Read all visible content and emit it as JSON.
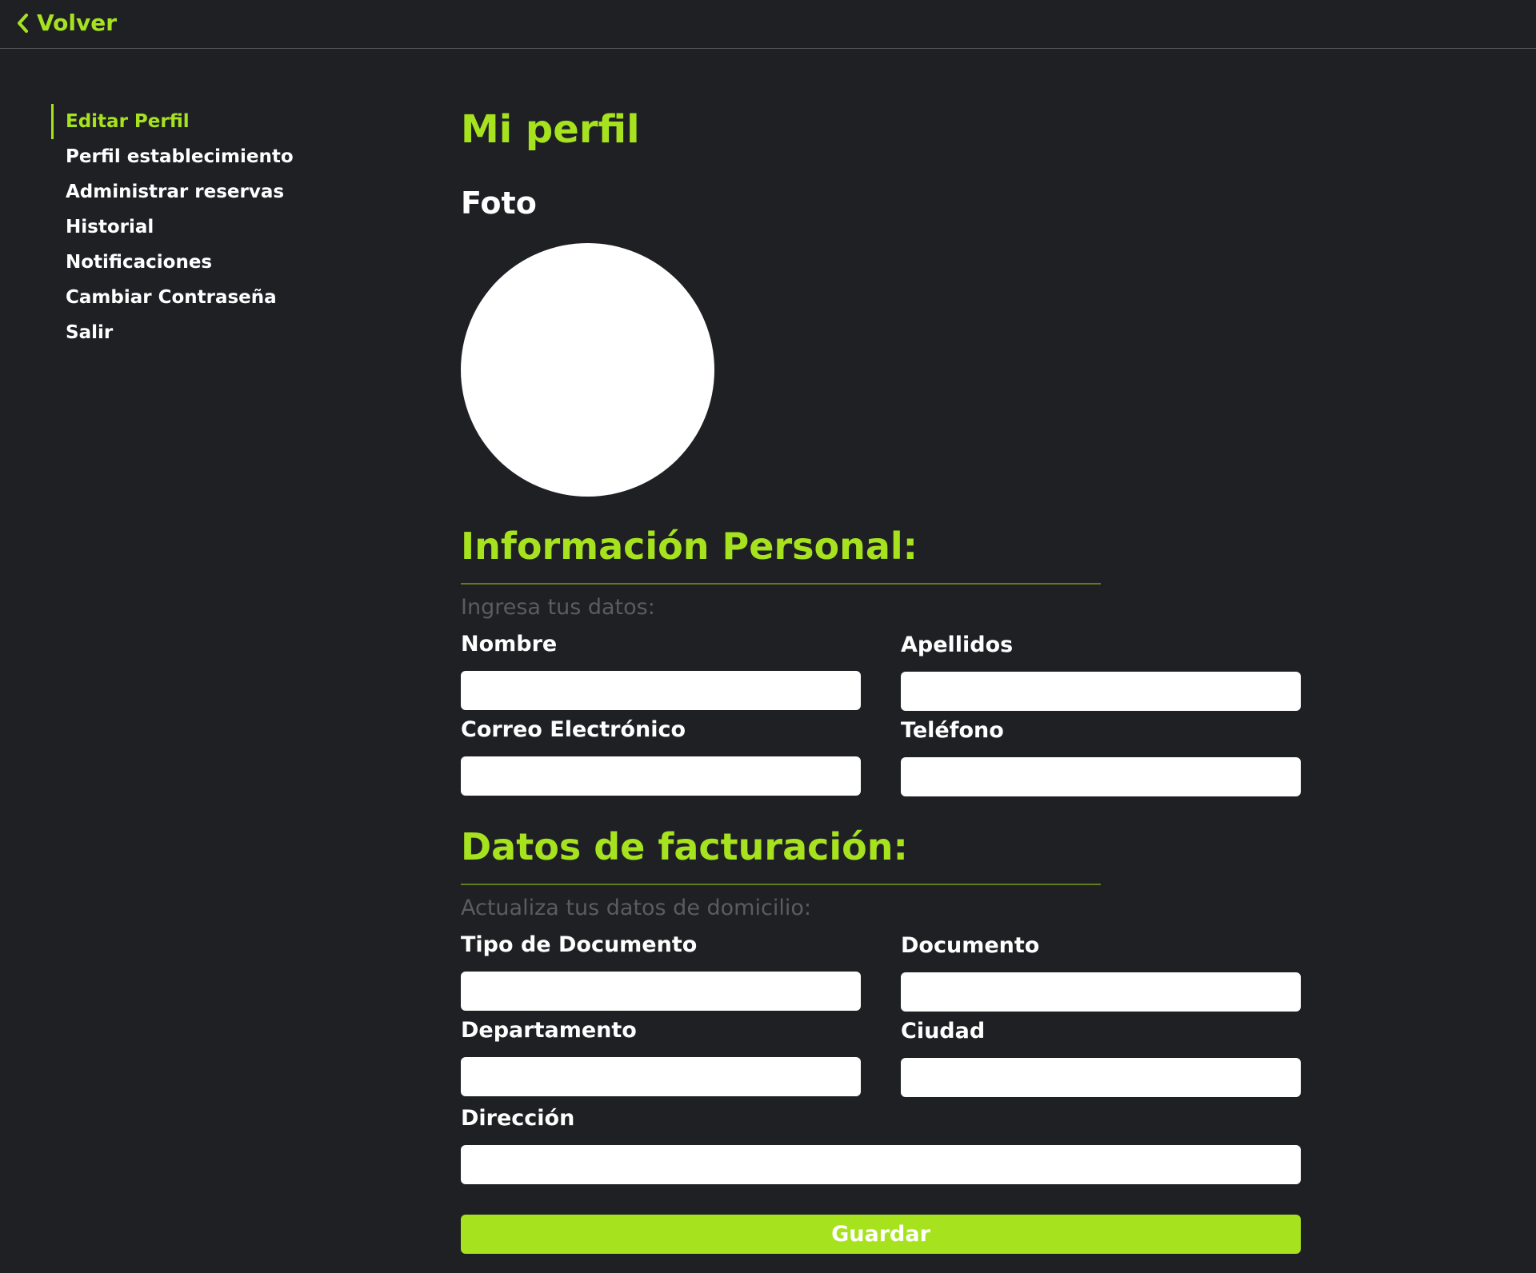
{
  "header": {
    "back_label": "Volver",
    "back_icon": "chevron-left-icon"
  },
  "sidebar": {
    "items": [
      {
        "label": "Editar Perfil",
        "active": true
      },
      {
        "label": "Perfil establecimiento",
        "active": false
      },
      {
        "label": "Administrar reservas",
        "active": false
      },
      {
        "label": "Historial",
        "active": false
      },
      {
        "label": "Notificaciones",
        "active": false
      },
      {
        "label": "Cambiar Contraseña",
        "active": false
      },
      {
        "label": "Salir",
        "active": false
      }
    ]
  },
  "main": {
    "title": "Mi perfil",
    "photo_label": "Foto",
    "personal": {
      "title": "Información Personal:",
      "subtitle": "Ingresa tus datos:",
      "fields": {
        "nombre": {
          "label": "Nombre",
          "value": ""
        },
        "apellidos": {
          "label": "Apellidos",
          "value": ""
        },
        "correo": {
          "label": "Correo Electrónico",
          "value": ""
        },
        "telefono": {
          "label": "Teléfono",
          "value": ""
        }
      }
    },
    "billing": {
      "title": "Datos de facturación:",
      "subtitle": "Actualiza tus datos de domicilio:",
      "fields": {
        "tipo_documento": {
          "label": "Tipo de Documento",
          "value": ""
        },
        "documento": {
          "label": "Documento",
          "value": ""
        },
        "departamento": {
          "label": "Departamento",
          "value": ""
        },
        "ciudad": {
          "label": "Ciudad",
          "value": ""
        },
        "direccion": {
          "label": "Dirección",
          "value": ""
        }
      }
    },
    "save_label": "Guardar"
  },
  "colors": {
    "background": "#1f2024",
    "accent": "#a6e31e",
    "muted_text": "#5b5c60",
    "text": "#ffffff"
  }
}
